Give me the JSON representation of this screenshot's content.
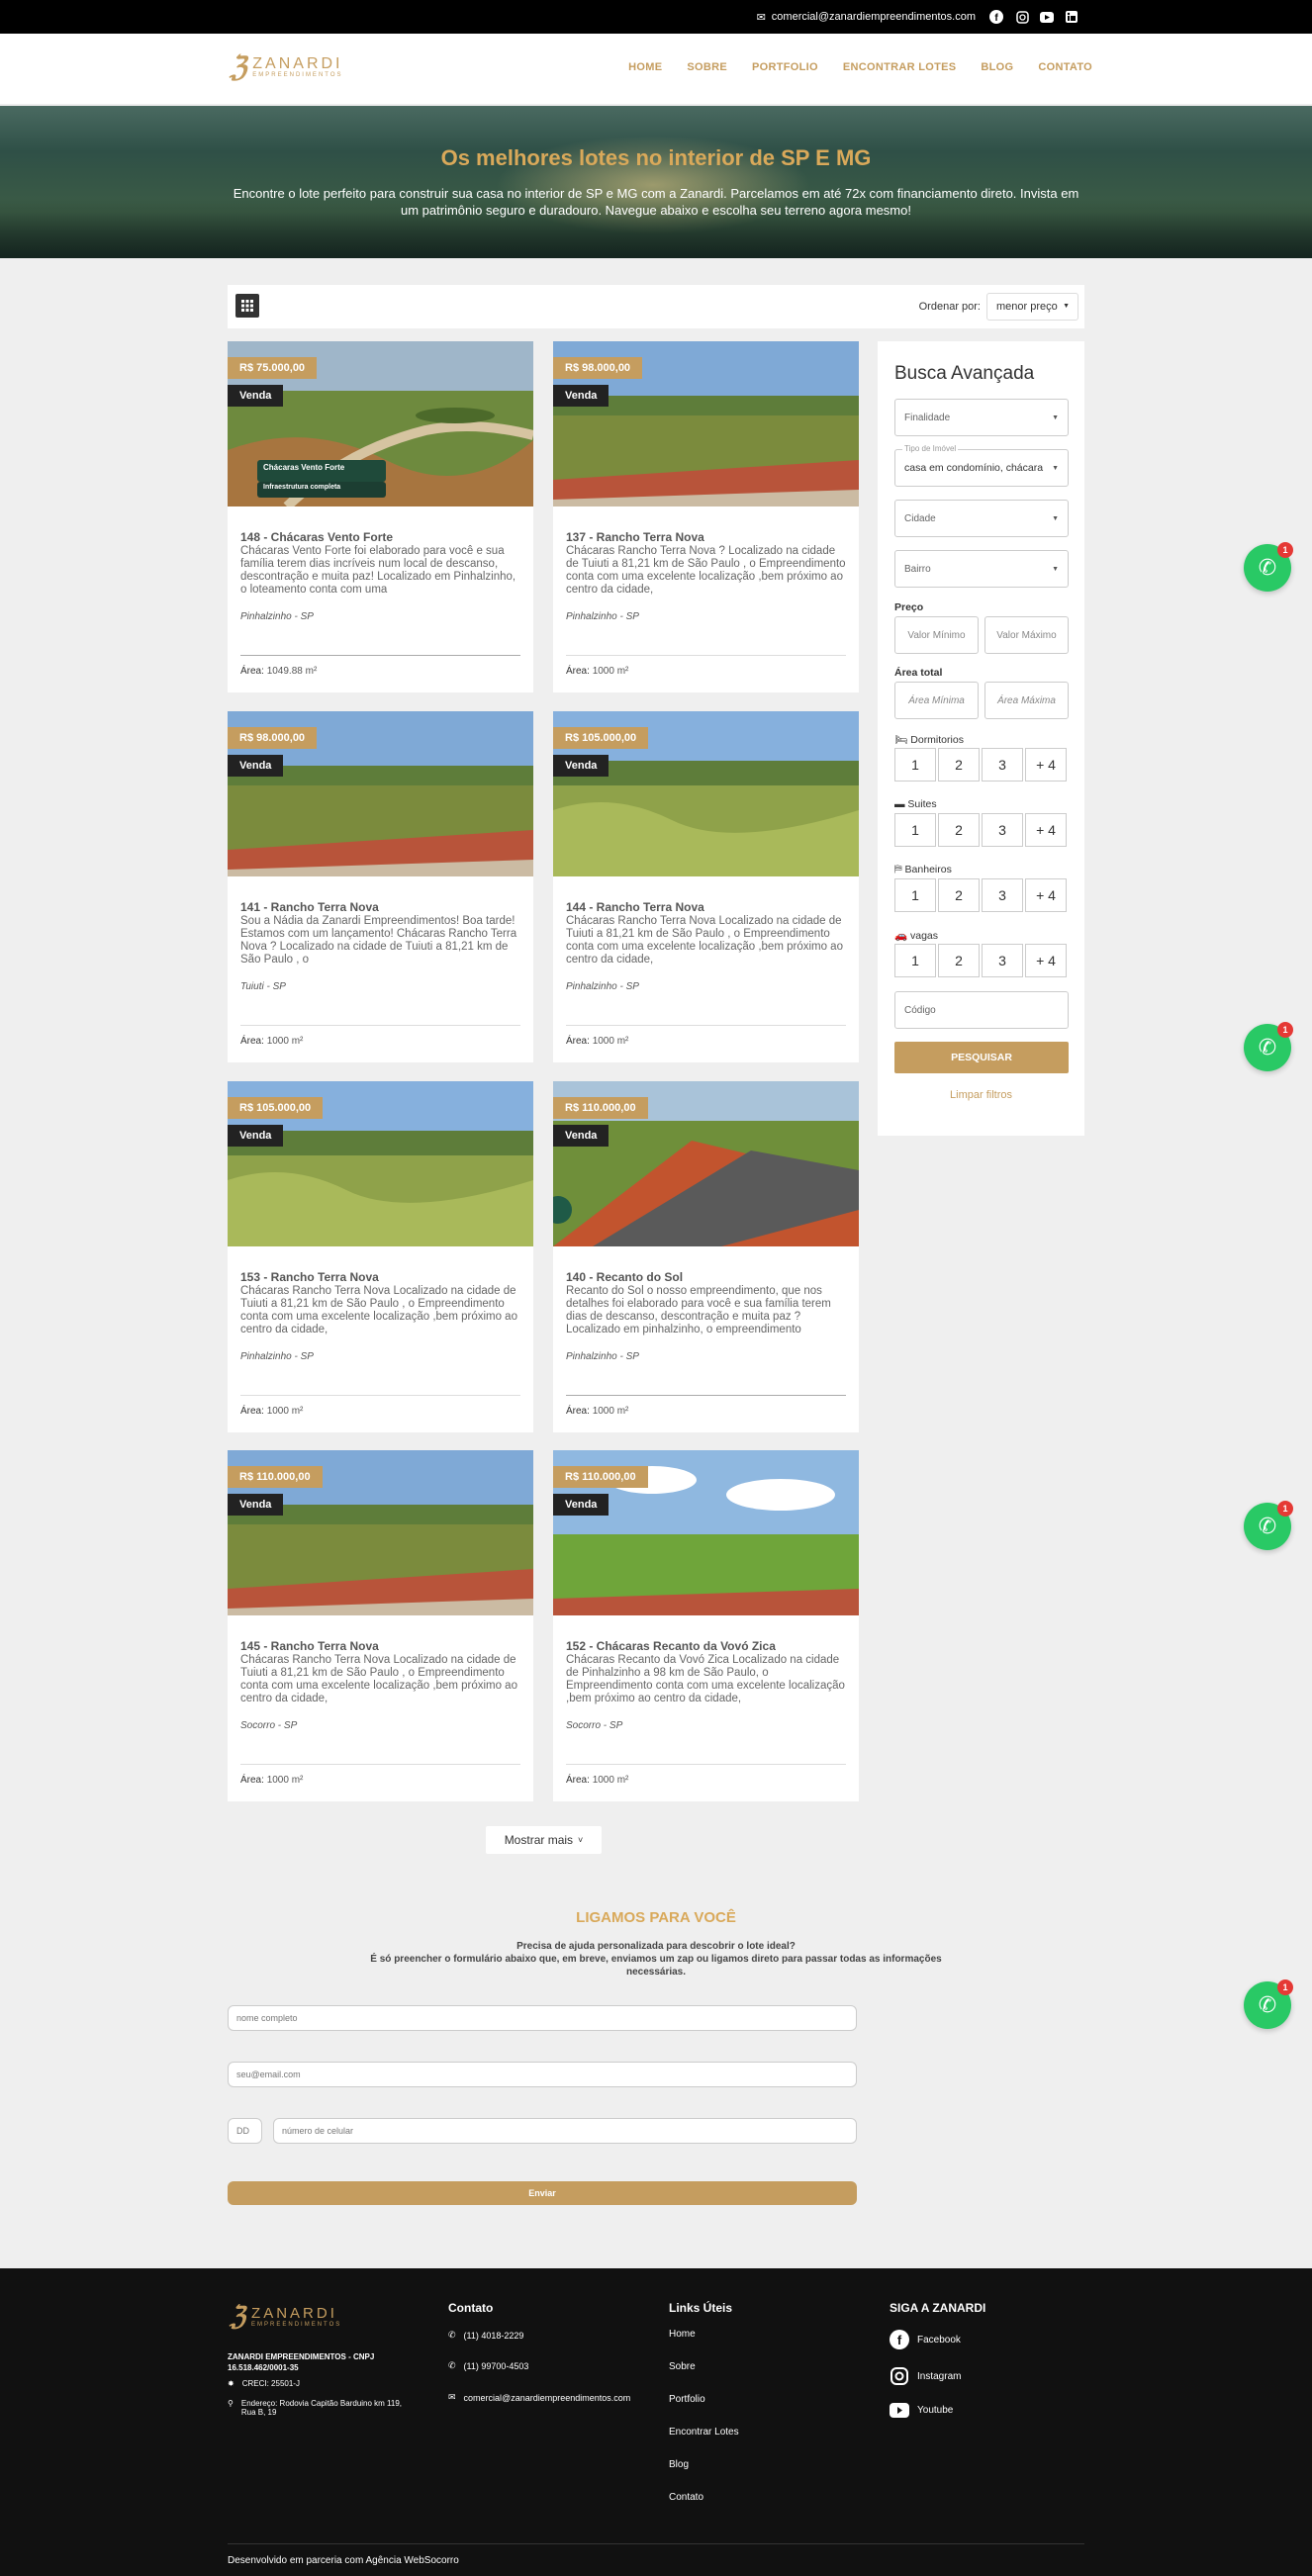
{
  "topbar": {
    "email": "comercial@zanardiempreendimentos.com",
    "social_icons": [
      "facebook-icon",
      "instagram-icon",
      "youtube-icon",
      "linkedin-icon"
    ]
  },
  "brand": {
    "name": "ZANARDI",
    "tagline": "EMPREENDIMENTOS",
    "color": "#c59d5f"
  },
  "nav": [
    "HOME",
    "SOBRE",
    "PORTFOLIO",
    "ENCONTRAR LOTES",
    "BLOG",
    "CONTATO"
  ],
  "hero": {
    "title": "Os melhores lotes no interior de SP E MG",
    "text": "Encontre o lote perfeito para construir sua casa no interior de SP e MG com a Zanardi. Parcelamos em até 72x com financiamento direto. Invista em um patrimônio seguro e duradouro. Navegue abaixo e escolha seu terreno agora mesmo!"
  },
  "toolbar": {
    "order_label": "Ordenar por:",
    "order_value": "menor preço"
  },
  "listings": [
    {
      "price": "R$ 75.000,00",
      "status": "Venda",
      "title": "148 - Chácaras Vento Forte",
      "desc": "Chácaras Vento Forte foi elaborado para você e sua família terem dias incríveis num local de descanso, descontração e muita paz! Localizado em Pinhalzinho, o loteamento conta com uma",
      "city": "Pinhalzinho - SP",
      "area_label": "Área:",
      "area": "1049.88 m²",
      "img_caption": "Chácaras Vento Forte",
      "img_caption2": "Infraestrutura completa"
    },
    {
      "price": "R$ 98.000,00",
      "status": "Venda",
      "title": "137 - Rancho Terra Nova",
      "desc": "Chácaras Rancho Terra Nova ? Localizado na cidade de Tuiuti a 81,21 km de São Paulo , o Empreendimento conta com uma excelente localização ,bem próximo ao centro da cidade,",
      "city": "Pinhalzinho - SP",
      "area_label": "Área:",
      "area": "1000 m²"
    },
    {
      "price": "R$ 98.000,00",
      "status": "Venda",
      "title": "141 - Rancho Terra Nova",
      "desc": "Sou a Nádia da Zanardi Empreendimentos! Boa tarde! Estamos com um lançamento! Chácaras Rancho Terra Nova ? Localizado na cidade de Tuiuti a 81,21 km de São Paulo , o",
      "city": "Tuiuti - SP",
      "area_label": "Área:",
      "area": "1000 m²"
    },
    {
      "price": "R$ 105.000,00",
      "status": "Venda",
      "title": "144 - Rancho Terra Nova",
      "desc": "Chácaras Rancho Terra Nova Localizado na cidade de Tuiuti a 81,21 km de São Paulo , o Empreendimento conta com uma excelente localização ,bem próximo ao centro da cidade,",
      "city": "Pinhalzinho - SP",
      "area_label": "Área:",
      "area": "1000 m²"
    },
    {
      "price": "R$ 105.000,00",
      "status": "Venda",
      "title": "153 - Rancho Terra Nova",
      "desc": "Chácaras Rancho Terra Nova Localizado na cidade de Tuiuti a 81,21 km de São Paulo , o Empreendimento conta com uma excelente localização ,bem próximo ao centro da cidade,",
      "city": "Pinhalzinho - SP",
      "area_label": "Área:",
      "area": "1000 m²"
    },
    {
      "price": "R$ 110.000,00",
      "status": "Venda",
      "title": "140 - Recanto do Sol",
      "desc": "Recanto do Sol o nosso empreendimento, que nos detalhes foi elaborado para você e sua família terem dias de descanso, descontração e muita paz ? Localizado em pinhalzinho, o empreendimento",
      "city": "Pinhalzinho - SP",
      "area_label": "Área:",
      "area": "1000 m²"
    },
    {
      "price": "R$ 110.000,00",
      "status": "Venda",
      "title": "145 - Rancho Terra Nova",
      "desc": "Chácaras Rancho Terra Nova Localizado na cidade de Tuiuti a 81,21 km de São Paulo , o Empreendimento conta com uma excelente localização ,bem próximo ao centro da cidade,",
      "city": "Socorro - SP",
      "area_label": "Área:",
      "area": "1000 m²"
    },
    {
      "price": "R$ 110.000,00",
      "status": "Venda",
      "title": "152 - Chácaras Recanto da Vovó Zica",
      "desc": "Chácaras Recanto da Vovó Zica Localizado na cidade de Pinhalzinho a 98 km de São Paulo, o Empreendimento conta com uma excelente localização ,bem próximo ao centro da cidade,",
      "city": "Socorro - SP",
      "area_label": "Área:",
      "area": "1000 m²"
    }
  ],
  "search": {
    "title": "Busca Avançada",
    "finalidade": "Finalidade",
    "tipo_label": "Tipo de Imóvel",
    "tipo_value": "casa em condomínio, chácara",
    "cidade": "Cidade",
    "bairro": "Bairro",
    "preco_label": "Preço",
    "valor_min": "Valor Mínimo",
    "valor_max": "Valor Máximo",
    "area_label": "Área total",
    "area_min": "Área Mínima",
    "area_max": "Área Máxima",
    "dormitorios": "Dormitorios",
    "suites": "Suites",
    "banheiros": "Banheiros",
    "vagas": "vagas",
    "options": [
      "1",
      "2",
      "3",
      "+ 4"
    ],
    "codigo": "Código",
    "button": "PESQUISAR",
    "clear": "Limpar filtros"
  },
  "whatsapp": {
    "badge": "1"
  },
  "more_button": "Mostrar mais",
  "contact_form": {
    "title": "LIGAMOS PARA VOCÊ",
    "line1": "Precisa de ajuda personalizada para descobrir o lote ideal?",
    "line2": "É só preencher o formulário abaixo que, em breve, enviamos um zap ou ligamos direto para passar todas as informações necessárias.",
    "name_ph": "nome completo",
    "email_ph": "seu@email.com",
    "ddd_ph": "DD",
    "phone_ph": "número de celular",
    "submit": "Enviar"
  },
  "footer": {
    "company": "ZANARDI EMPREENDIMENTOS - CNPJ 16.518.462/0001-35",
    "creci": "CRECI: 25501-J",
    "address": "Endereço: Rodovia Capitão Barduino km 119, Rua B, 19",
    "contato_title": "Contato",
    "phone1": "(11) 4018-2229",
    "phone2": "(11) 99700-4503",
    "email": "comercial@zanardiempreendimentos.com",
    "links_title": "Links Úteis",
    "links": [
      "Home",
      "Sobre",
      "Portfolio",
      "Encontrar Lotes",
      "Blog",
      "Contato"
    ],
    "social_title": "SIGA A ZANARDI",
    "social": [
      "Facebook",
      "Instagram",
      "Youtube"
    ],
    "credit": "Desenvolvido em parceria com Agência WebSocorro"
  }
}
